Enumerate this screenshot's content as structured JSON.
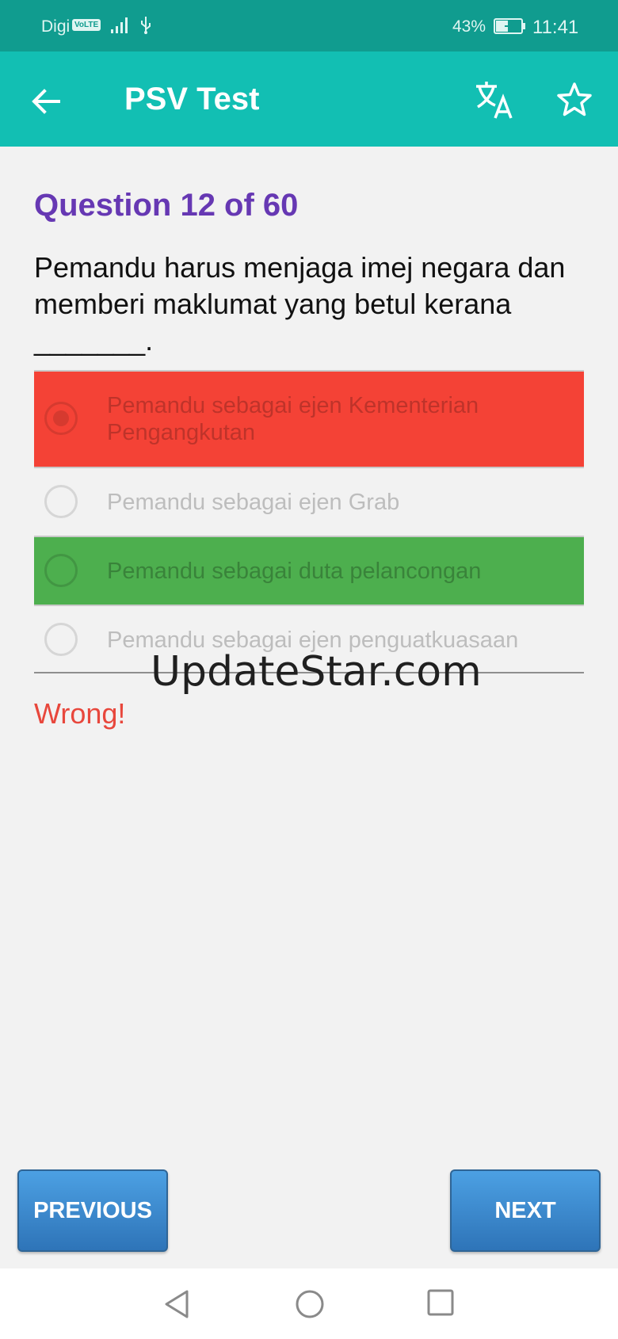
{
  "status_bar": {
    "carrier": "Digi",
    "volte": "VoLTE",
    "battery_percent": "43%",
    "time": "11:41",
    "icons": [
      "signal-icon",
      "usb-icon",
      "battery-charging-icon"
    ]
  },
  "app_bar": {
    "title": "PSV Test",
    "icons": [
      "back-arrow-icon",
      "translate-icon",
      "star-outline-icon"
    ]
  },
  "question": {
    "number_label": "Question 12 of 60",
    "text": "Pemandu harus menjaga imej negara dan memberi maklumat yang betul kerana _______."
  },
  "options": [
    {
      "label": "Pemandu sebagai ejen Kementerian Pengangkutan",
      "state": "selected-wrong"
    },
    {
      "label": "Pemandu sebagai ejen Grab",
      "state": "none"
    },
    {
      "label": "Pemandu sebagai duta pelancongan",
      "state": "correct"
    },
    {
      "label": "Pemandu sebagai ejen penguatkuasaan",
      "state": "none"
    }
  ],
  "watermark": "UpdateStar.com",
  "result": "Wrong!",
  "buttons": {
    "previous": "PREVIOUS",
    "next": "NEXT"
  },
  "colors": {
    "status_bar": "#109c8f",
    "app_bar": "#12bfb3",
    "question_number": "#6638b3",
    "wrong_bg": "#f44236",
    "correct_bg": "#4daf4e",
    "result_text": "#e8473c",
    "button": "#3a8ad0"
  }
}
